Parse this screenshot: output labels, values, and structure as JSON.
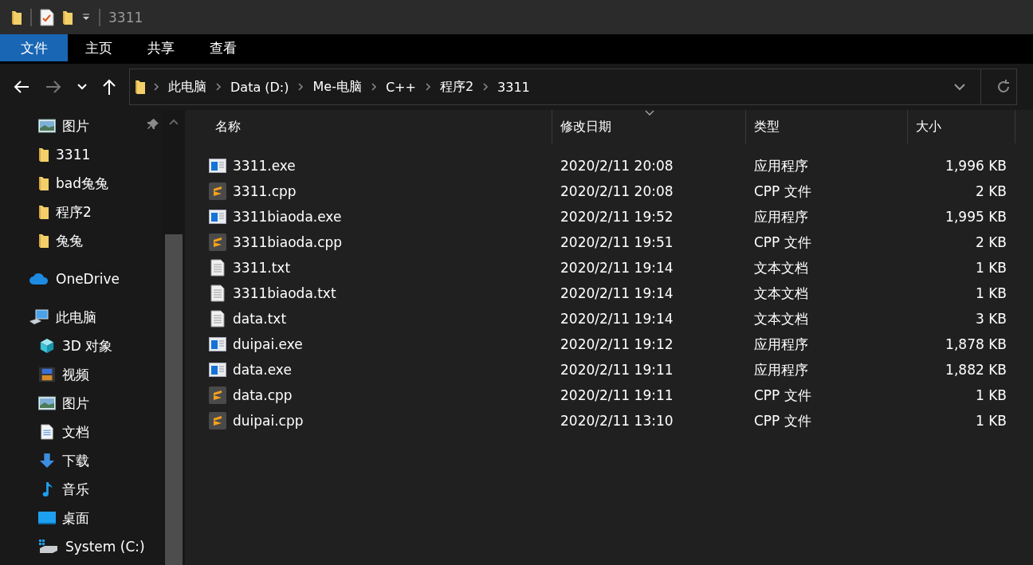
{
  "title_bar": {
    "title": "3311"
  },
  "ribbon_tabs": [
    {
      "label": "文件",
      "selected": true
    },
    {
      "label": "主页",
      "selected": false
    },
    {
      "label": "共享",
      "selected": false
    },
    {
      "label": "查看",
      "selected": false
    }
  ],
  "breadcrumb": [
    "此电脑",
    "Data (D:)",
    "Me-电脑",
    "C++",
    "程序2",
    "3311"
  ],
  "sidebar": {
    "items": [
      {
        "kind": "picture",
        "label": "图片",
        "pinned": true
      },
      {
        "kind": "folder",
        "label": "3311",
        "pinned": false
      },
      {
        "kind": "folder",
        "label": "bad兔兔",
        "pinned": false
      },
      {
        "kind": "folder",
        "label": "程序2",
        "pinned": false
      },
      {
        "kind": "folder",
        "label": "兔兔",
        "pinned": false
      },
      {
        "kind": "cloud",
        "label": "OneDrive",
        "pinned": false
      },
      {
        "kind": "pc",
        "label": "此电脑",
        "pinned": false
      },
      {
        "kind": "cube",
        "label": "3D 对象",
        "pinned": false
      },
      {
        "kind": "video",
        "label": "视频",
        "pinned": false
      },
      {
        "kind": "picture",
        "label": "图片",
        "pinned": false
      },
      {
        "kind": "document",
        "label": "文档",
        "pinned": false
      },
      {
        "kind": "download",
        "label": "下载",
        "pinned": false
      },
      {
        "kind": "music",
        "label": "音乐",
        "pinned": false
      },
      {
        "kind": "desktop",
        "label": "桌面",
        "pinned": false
      },
      {
        "kind": "drive",
        "label": "System (C:)",
        "pinned": false
      }
    ]
  },
  "table": {
    "columns": [
      {
        "label": "名称",
        "sorted": false
      },
      {
        "label": "修改日期",
        "sorted": true
      },
      {
        "label": "类型",
        "sorted": false
      },
      {
        "label": "大小",
        "sorted": false
      }
    ],
    "rows": [
      {
        "kind": "exe",
        "name": "3311.exe",
        "modified": "2020/2/11 20:08",
        "type": "应用程序",
        "size": "1,996 KB"
      },
      {
        "kind": "cpp",
        "name": "3311.cpp",
        "modified": "2020/2/11 20:08",
        "type": "CPP 文件",
        "size": "2 KB"
      },
      {
        "kind": "exe",
        "name": "3311biaoda.exe",
        "modified": "2020/2/11 19:52",
        "type": "应用程序",
        "size": "1,995 KB"
      },
      {
        "kind": "cpp",
        "name": "3311biaoda.cpp",
        "modified": "2020/2/11 19:51",
        "type": "CPP 文件",
        "size": "2 KB"
      },
      {
        "kind": "txt",
        "name": "3311.txt",
        "modified": "2020/2/11 19:14",
        "type": "文本文档",
        "size": "1 KB"
      },
      {
        "kind": "txt",
        "name": "3311biaoda.txt",
        "modified": "2020/2/11 19:14",
        "type": "文本文档",
        "size": "1 KB"
      },
      {
        "kind": "txt",
        "name": "data.txt",
        "modified": "2020/2/11 19:14",
        "type": "文本文档",
        "size": "3 KB"
      },
      {
        "kind": "exe",
        "name": "duipai.exe",
        "modified": "2020/2/11 19:12",
        "type": "应用程序",
        "size": "1,878 KB"
      },
      {
        "kind": "exe",
        "name": "data.exe",
        "modified": "2020/2/11 19:11",
        "type": "应用程序",
        "size": "1,882 KB"
      },
      {
        "kind": "cpp",
        "name": "data.cpp",
        "modified": "2020/2/11 19:11",
        "type": "CPP 文件",
        "size": "1 KB"
      },
      {
        "kind": "cpp",
        "name": "duipai.cpp",
        "modified": "2020/2/11 13:10",
        "type": "CPP 文件",
        "size": "1 KB"
      }
    ]
  }
}
